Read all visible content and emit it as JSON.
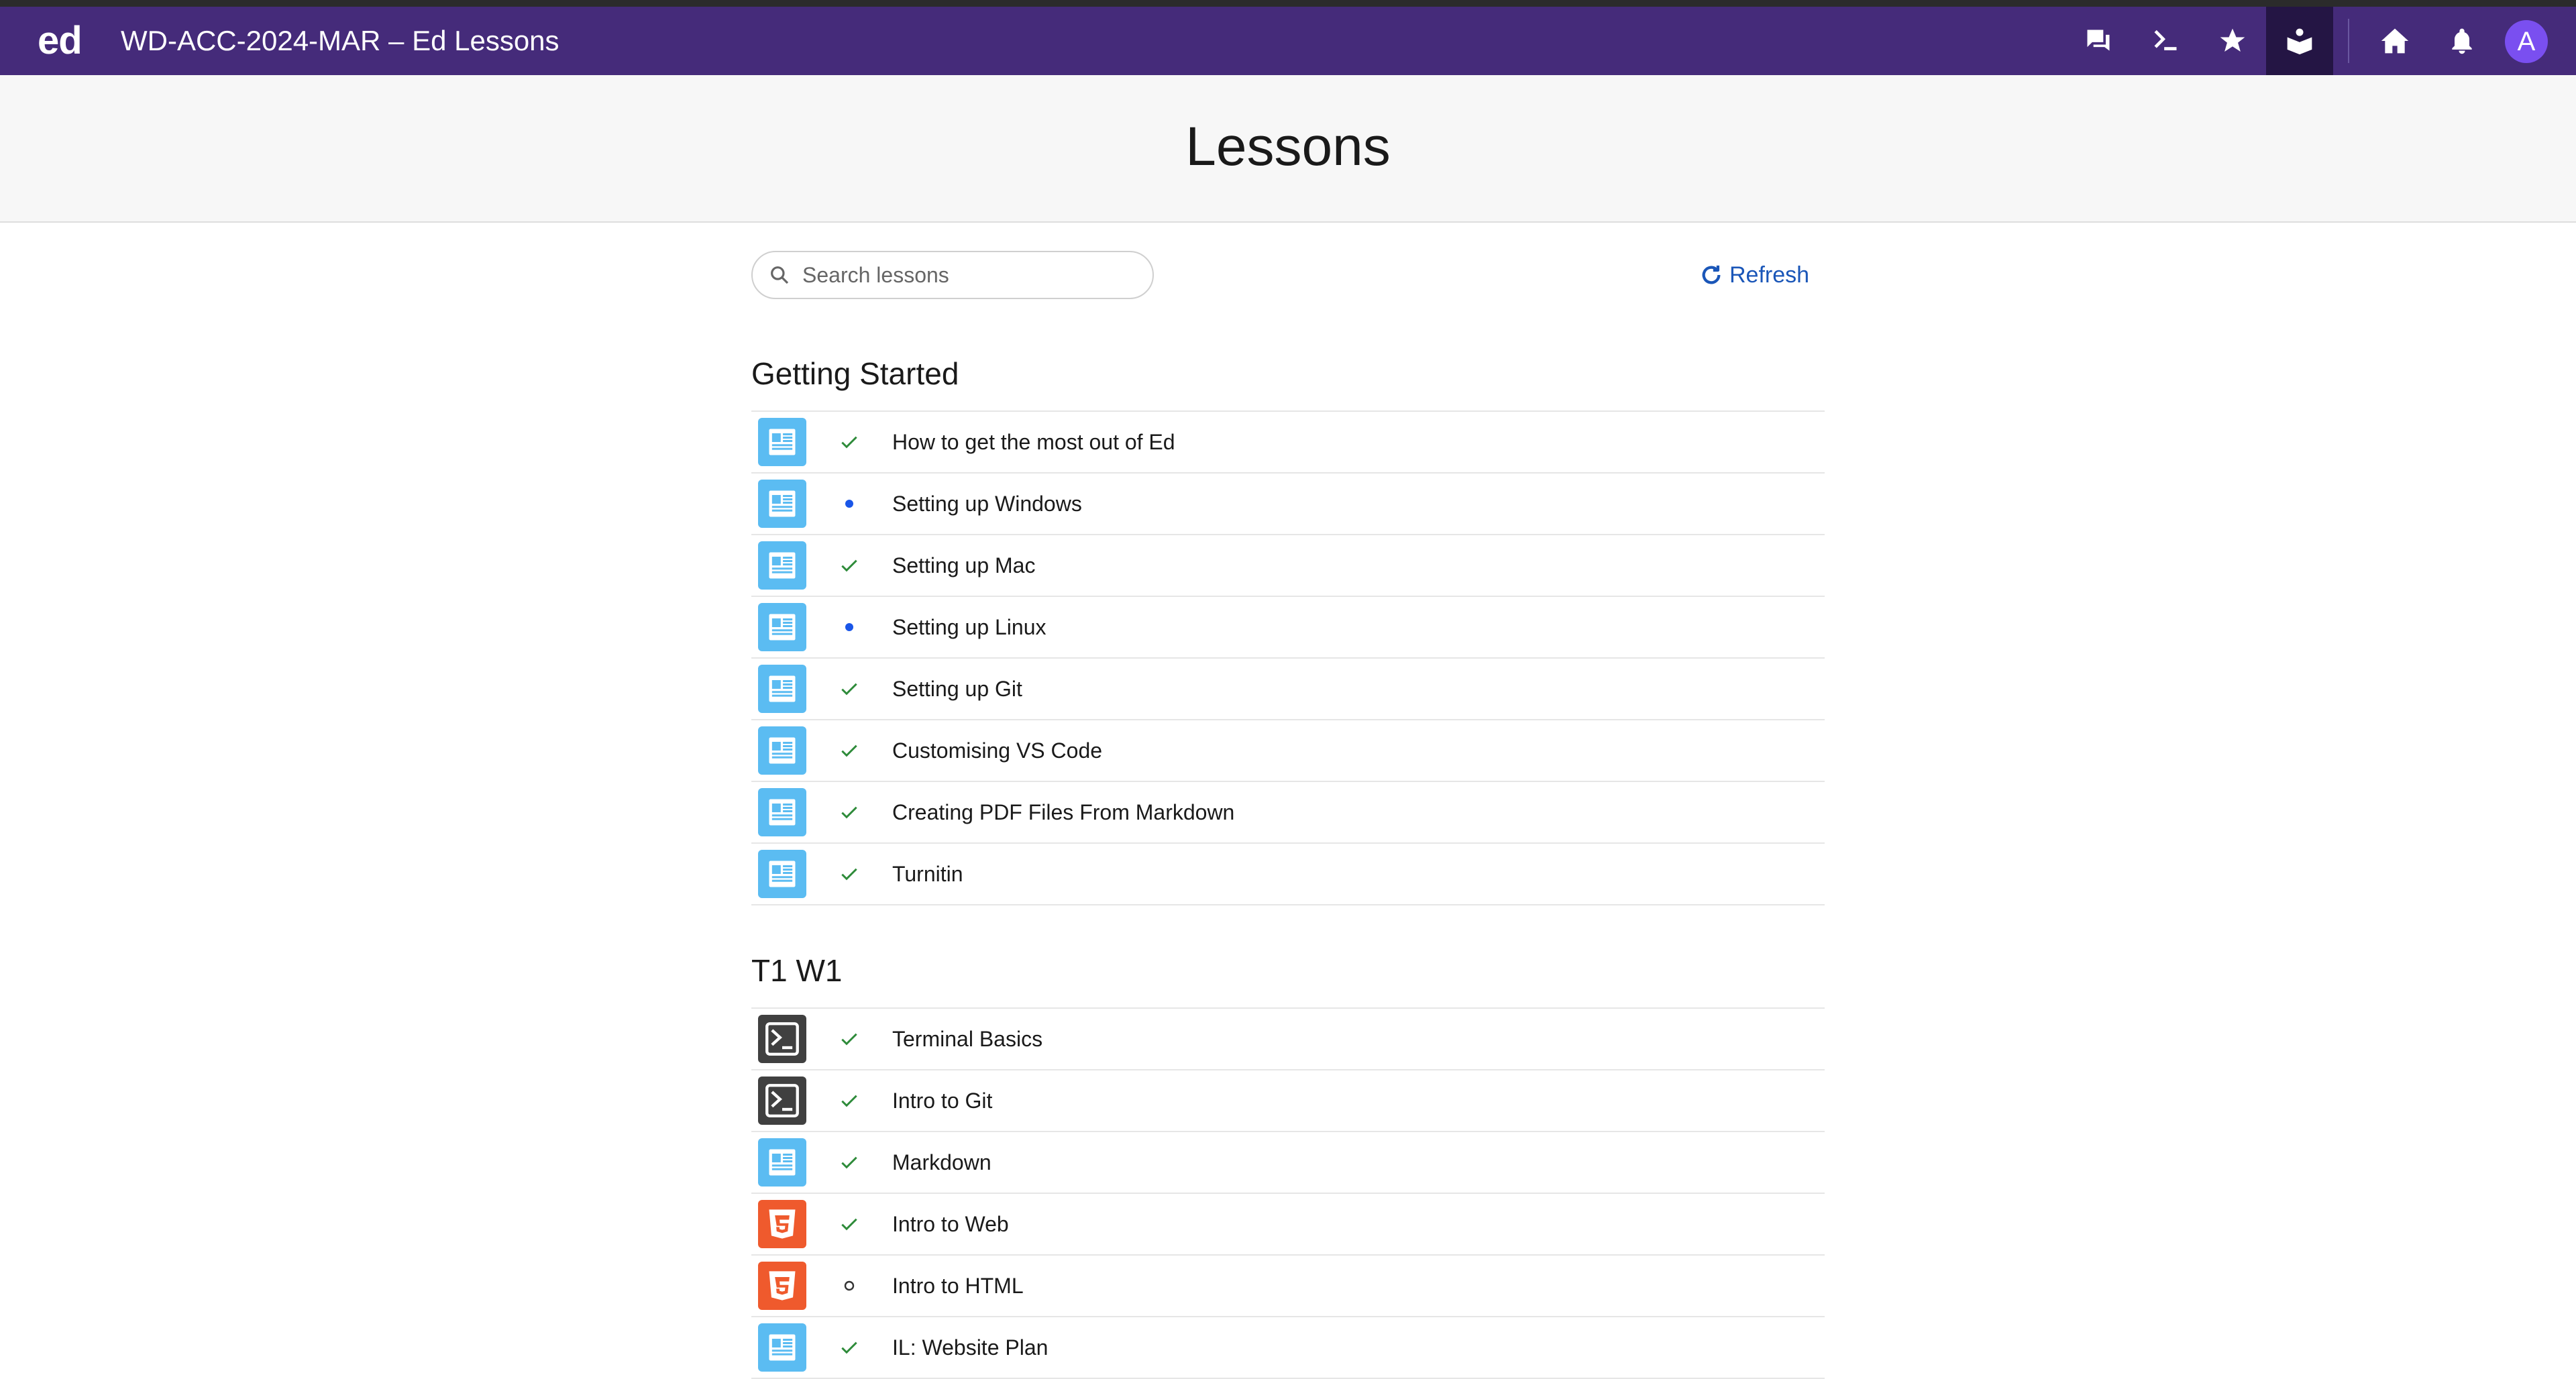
{
  "app": {
    "logo": "ed",
    "title": "WD-ACC-2024-MAR – Ed Lessons",
    "avatar_letter": "A",
    "nav_icons": [
      "chat-icon",
      "terminal-icon",
      "star-icon",
      "lessons-icon",
      "home-icon",
      "bell-icon"
    ],
    "brand_color": "#452b7a"
  },
  "page": {
    "heading": "Lessons",
    "search_placeholder": "Search lessons",
    "refresh_label": "Refresh"
  },
  "sections": [
    {
      "title": "Getting Started",
      "lessons": [
        {
          "title": "How to get the most out of Ed",
          "type": "document",
          "status": "completed"
        },
        {
          "title": "Setting up Windows",
          "type": "document",
          "status": "new"
        },
        {
          "title": "Setting up Mac",
          "type": "document",
          "status": "completed"
        },
        {
          "title": "Setting up Linux",
          "type": "document",
          "status": "new"
        },
        {
          "title": "Setting up Git",
          "type": "document",
          "status": "completed"
        },
        {
          "title": "Customising VS Code",
          "type": "document",
          "status": "completed"
        },
        {
          "title": "Creating PDF Files From Markdown",
          "type": "document",
          "status": "completed"
        },
        {
          "title": "Turnitin",
          "type": "document",
          "status": "completed"
        }
      ]
    },
    {
      "title": "T1 W1",
      "lessons": [
        {
          "title": "Terminal Basics",
          "type": "terminal",
          "status": "completed"
        },
        {
          "title": "Intro to Git",
          "type": "terminal",
          "status": "completed"
        },
        {
          "title": "Markdown",
          "type": "document",
          "status": "completed"
        },
        {
          "title": "Intro to Web",
          "type": "html",
          "status": "completed"
        },
        {
          "title": "Intro to HTML",
          "type": "html",
          "status": "incomplete"
        },
        {
          "title": "IL: Website Plan",
          "type": "document",
          "status": "completed"
        }
      ]
    }
  ]
}
